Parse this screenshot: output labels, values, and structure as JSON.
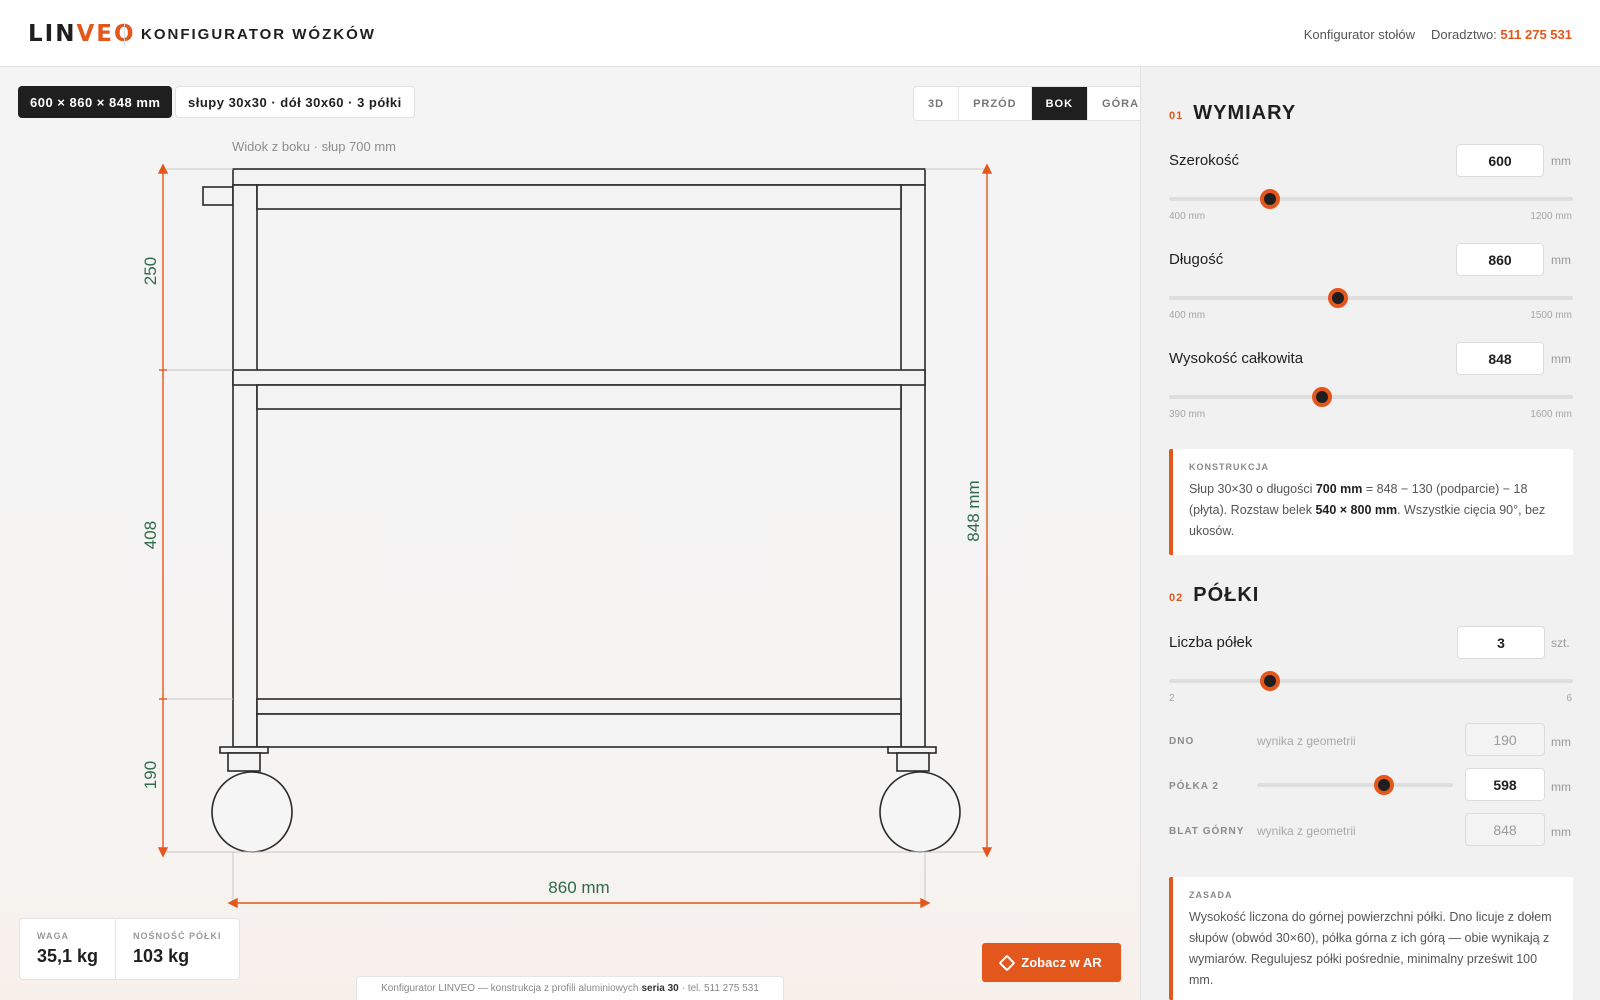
{
  "header": {
    "logo_a": "LIN",
    "logo_b": "VEO",
    "title": "KONFIGURATOR WÓZKÓW",
    "link_tables": "Konfigurator stołów",
    "advice_label": "Doradztwo:",
    "phone": "511 275 531"
  },
  "canvas": {
    "dims_chip": "600 × 860 × 848 mm",
    "spec_chip": "słupy 30x30 · dół 30x60 · 3 półki",
    "view_caption": "Widok z boku · słup 700 mm",
    "views": [
      "3D",
      "PRZÓD",
      "BOK",
      "GÓRA"
    ],
    "active_view": "BOK",
    "dim_250": "250",
    "dim_408": "408",
    "dim_190": "190",
    "dim_total_height": "848 mm",
    "dim_length": "860 mm",
    "stats": {
      "weight_label": "WAGA",
      "weight_value": "35,1 kg",
      "capacity_label": "NOŚNOŚĆ PÓŁKI",
      "capacity_value": "103 kg"
    },
    "footnote_a": "Konfigurator LINVEO — konstrukcja z profili aluminiowych",
    "footnote_b": "seria 30",
    "footnote_c": "· tel. 511 275 531",
    "ar_button": "Zobacz w AR"
  },
  "sidebar": {
    "s1_num": "01",
    "s1_title": "WYMIARY",
    "width": {
      "label": "Szerokość",
      "value": "600",
      "unit": "mm",
      "min": "400 mm",
      "max": "1200 mm",
      "level": 0.25
    },
    "length": {
      "label": "Długość",
      "value": "860",
      "unit": "mm",
      "min": "400 mm",
      "max": "1500 mm",
      "level": 0.418
    },
    "height": {
      "label": "Wysokość całkowita",
      "value": "848",
      "unit": "mm",
      "min": "390 mm",
      "max": "1600 mm",
      "level": 0.379
    },
    "note1": {
      "title": "KONSTRUKCJA",
      "t1": "Słup 30×30 o długości ",
      "b1": "700 mm",
      "t2": " = 848 − 130 (podparcie) − 18 (płyta). Rozstaw belek ",
      "b2": "540 × 800 mm",
      "t3": ". Wszystkie cięcia 90°, bez ukosów."
    },
    "s2_num": "02",
    "s2_title": "PÓŁKI",
    "shelves": {
      "label": "Liczba półek",
      "value": "3",
      "unit": "szt.",
      "min": "2",
      "max": "6",
      "level": 0.25
    },
    "rows": [
      {
        "label": "DNO",
        "hint": "wynika z geometrii",
        "value": "190",
        "unit": "mm"
      },
      {
        "label": "PÓŁKA 2",
        "value": "598",
        "unit": "mm",
        "level": 0.65
      },
      {
        "label": "BLAT GÓRNY",
        "hint": "wynika z geometrii",
        "value": "848",
        "unit": "mm"
      }
    ],
    "note2": {
      "title": "ZASADA",
      "text": "Wysokość liczona do górnej powierzchni półki. Dno licuje z dołem słupów (obwód 30×60), półka górna z ich górą — obie wynikają z wymiarów. Regulujesz półki pośrednie, minimalny prześwit 100 mm."
    }
  }
}
